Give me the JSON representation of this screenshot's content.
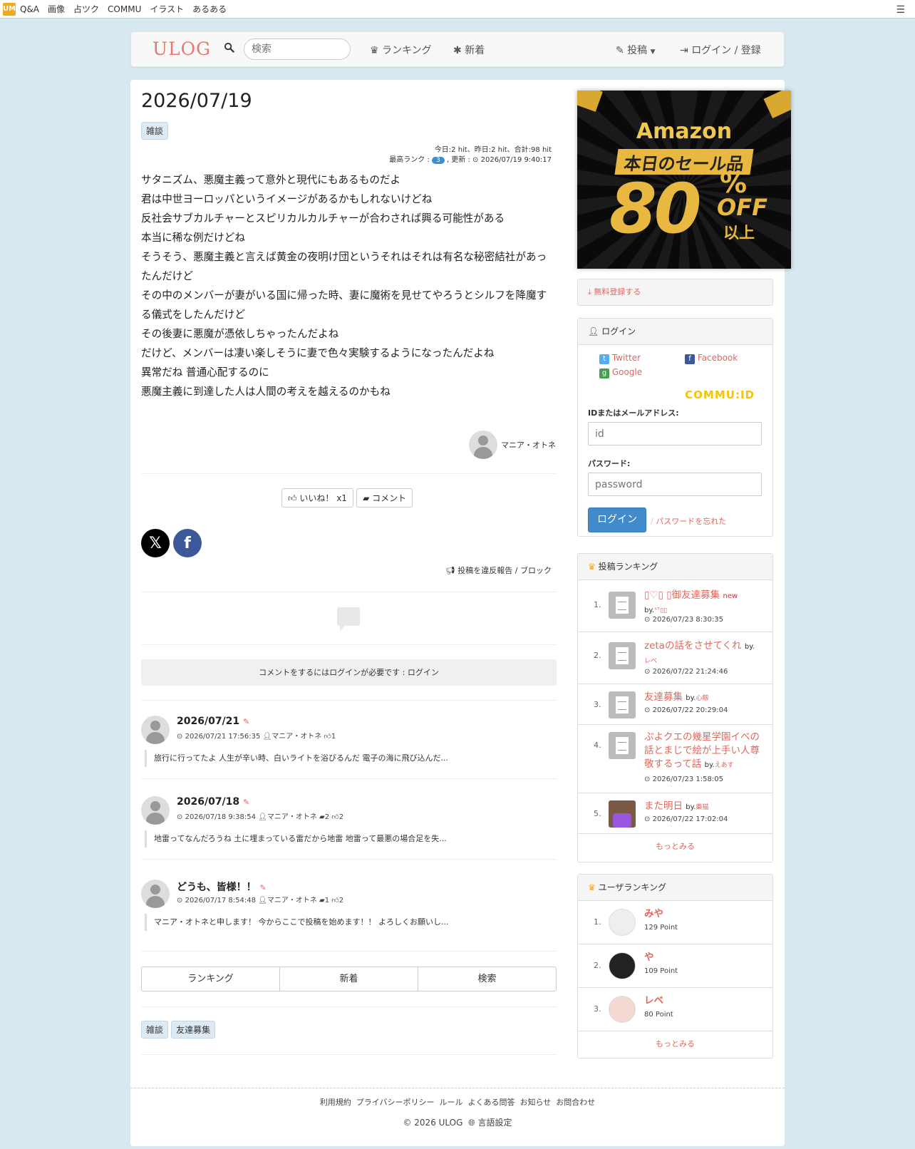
{
  "topbar": {
    "logo": "UM",
    "links": [
      "Q&A",
      "画像",
      "占ツク",
      "COMMU",
      "イラスト",
      "あるある"
    ],
    "menu_icon": "hamburger-icon"
  },
  "header": {
    "brand": "ULOG",
    "search_placeholder": "検索",
    "nav_ranking": "ランキング",
    "nav_new": "新着",
    "nav_post": "投稿",
    "nav_login": "ログイン / 登録"
  },
  "post": {
    "title": "2026/07/19",
    "tag": "雑談",
    "meta_line1": "今日:2 hit、昨日:2 hit、合計:98 hit",
    "meta_rank_label": "最高ランク :",
    "meta_rank": "3",
    "meta_updated": ", 更新 :",
    "meta_datetime": "2026/07/19 9:40:17",
    "body": [
      "サタニズム、悪魔主義って意外と現代にもあるものだよ",
      "君は中世ヨーロッパというイメージがあるかもしれないけどね",
      "反社会サブカルチャーとスピリカルカルチャーが合わされば興る可能性がある",
      "本当に稀な例だけどね",
      "そうそう、悪魔主義と言えば黄金の夜明け団というそれはそれは有名な秘密結社があったんだけど",
      "その中のメンバーが妻がいる国に帰った時、妻に魔術を見せてやろうとシルフを降魔する儀式をしたんだけど",
      "その後妻に悪魔が憑依しちゃったんだよね",
      "だけど、メンバーは凄い楽しそうに妻で色々実験するようになったんだよね",
      "異常だね 普通心配するのに",
      "悪魔主義に到達した人は人間の考えを越えるのかもね"
    ],
    "author": "マニア・オトネ",
    "like_label": "いいね！ x1",
    "comment_label": "コメント",
    "report_label": "投稿を違反報告 / ブロック",
    "login_required": "コメントをするにはログインが必要です : ログイン"
  },
  "other_posts": [
    {
      "title": "2026/07/21",
      "datetime": "2026/07/21 17:56:35",
      "author": "マニア・オトネ",
      "comments": "",
      "likes": "1",
      "snippet": "旅行に行ってたよ 人生が辛い時、白いライトを浴びるんだ 電子の海に飛び込んだ..."
    },
    {
      "title": "2026/07/18",
      "datetime": "2026/07/18 9:38:54",
      "author": "マニア・オトネ",
      "comments": "2",
      "likes": "2",
      "snippet": "地雷ってなんだろうね 土に埋まっている雷だから地雷 地雷って最悪の場合足を失..."
    },
    {
      "title": "どうも、皆様！！",
      "datetime": "2026/07/17 8:54:48",
      "author": "マニア・オトネ",
      "comments": "1",
      "likes": "2",
      "snippet": "マニア・オトネと申します！ 今からここで投稿を始めます！！ よろしくお願いし..."
    }
  ],
  "bottom_tabs": [
    "ランキング",
    "新着",
    "検索"
  ],
  "bottom_tags": [
    "雑談",
    "友達募集"
  ],
  "ad": {
    "brand": "Amazon",
    "headline": "本日のセール品",
    "number": "80",
    "percent": "%",
    "off": "OFF",
    "suffix": "以上"
  },
  "sidebar": {
    "register": "無料登録する",
    "login_head": "ログイン",
    "twitter": "Twitter",
    "facebook": "Facebook",
    "google": "Google",
    "commu_id": "COMMU:ID",
    "id_label": "IDまたはメールアドレス:",
    "id_placeholder": "id",
    "pw_label": "パスワード:",
    "pw_placeholder": "password",
    "login_btn": "ログイン",
    "forgot": "パスワードを忘れた",
    "post_rank_head": "投稿ランキング",
    "post_rank": [
      {
        "num": "1.",
        "title": "▯♡▯ ▯御友達募集",
        "new": "new",
        "by": "by.",
        "user": "ᄓ▯▯",
        "datetime": "2026/07/23 8:30:35"
      },
      {
        "num": "2.",
        "title": "zetaの話をさせてくれ",
        "new": "",
        "by": "by.",
        "user": "レベ",
        "datetime": "2026/07/22 21:24:46"
      },
      {
        "num": "3.",
        "title": "友達募集",
        "new": "",
        "by": "by.",
        "user": "心劔",
        "datetime": "2026/07/22 20:29:04"
      },
      {
        "num": "4.",
        "title": "ぷよクエの幾星学園イベの話とまじで絵が上手い人尊敬するって話",
        "new": "",
        "by": "by.",
        "user": "えあす",
        "datetime": "2026/07/23 1:58:05"
      },
      {
        "num": "5.",
        "title": "また明日",
        "new": "",
        "by": "by.",
        "user": "藥猫",
        "datetime": "2026/07/22 17:02:04"
      }
    ],
    "more": "もっとみる",
    "user_rank_head": "ユーザランキング",
    "user_rank": [
      {
        "num": "1.",
        "name": "みや",
        "points": "129 Point"
      },
      {
        "num": "2.",
        "name": "や",
        "points": "109 Point"
      },
      {
        "num": "3.",
        "name": "レベ",
        "points": "80 Point"
      }
    ]
  },
  "footer": {
    "links": [
      "利用規約",
      "プライバシーポリシー",
      "ルール",
      "よくある問答",
      "お知らせ",
      "お問合わせ"
    ],
    "copyright": "© 2026 ULOG",
    "language": "言語設定"
  }
}
